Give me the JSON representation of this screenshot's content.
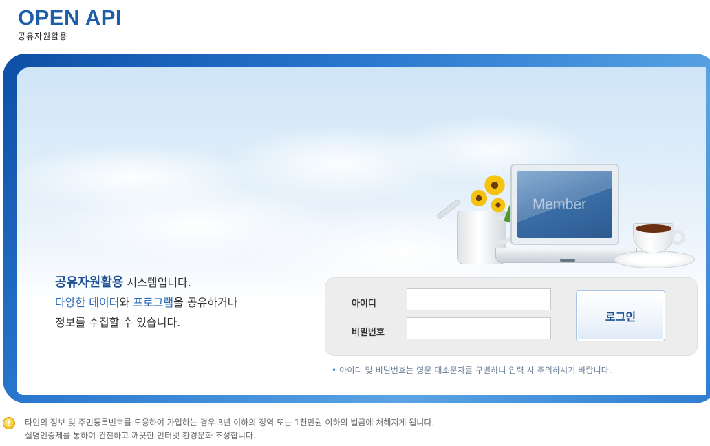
{
  "header": {
    "logo_title": "OPEN API",
    "logo_subtitle": "공유자원활용"
  },
  "illustration": {
    "screen_text": "Member"
  },
  "intro": {
    "line1_strong": "공유자원활용",
    "line1_rest": " 시스템입니다.",
    "line2_blue1": "다양한 데이터",
    "line2_mid": "와 ",
    "line2_blue2": "프로그램",
    "line2_rest": "을 공유하거나",
    "line3": "정보를 수집할 수 있습니다."
  },
  "login": {
    "id_label": "아이디",
    "id_value": "",
    "pw_label": "비밀번호",
    "pw_value": "",
    "button_label": "로그인",
    "notice_bullet": "•",
    "notice": "아이디 및 비밀번호는 영문 대소문자를 구별하니 입력 시 주의하시기 바랍니다."
  },
  "footer": {
    "warning_icon": "!",
    "line1": "타인의 정보 및 주민등록번호를 도용하여 가입하는 경우 3년 이하의 징역 또는 1천만원 이하의 벌금에 처해지게 됩니다.",
    "line2": "실명인증제를 통하여 건전하고 깨끗한 인터넷 환경문화 조성합니다."
  },
  "colors": {
    "brand_blue": "#1c5fa8",
    "frame_blue": "#2a78cf",
    "link_blue": "#2a6ab8"
  }
}
